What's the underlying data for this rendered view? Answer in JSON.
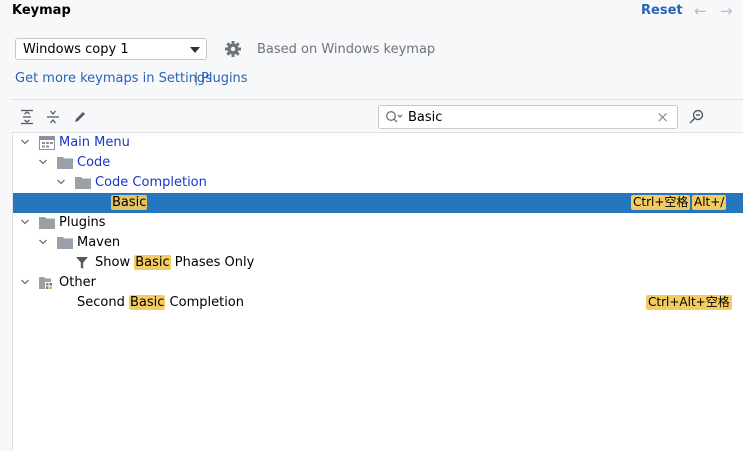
{
  "header": {
    "title": "Keymap",
    "reset_label": "Reset",
    "back_arrow": "←",
    "forward_arrow": "→"
  },
  "keymap_select": {
    "selected": "Windows copy 1",
    "based_on": "Based on Windows keymap"
  },
  "links": {
    "get_more_prefix": "Get more keymaps in Settings",
    "separator": "|",
    "plugins": "Plugins"
  },
  "search": {
    "value": "Basic",
    "clear": "×"
  },
  "tree": {
    "main_menu": "Main Menu",
    "code": "Code",
    "code_completion": "Code Completion",
    "basic": "Basic",
    "basic_shortcut_1": "Ctrl+空格",
    "basic_shortcut_2": "Alt+/",
    "plugins": "Plugins",
    "maven": "Maven",
    "show_prefix": "Show ",
    "show_highlight": "Basic",
    "show_suffix": " Phases Only",
    "other": "Other",
    "second_prefix": "Second ",
    "second_highlight": "Basic",
    "second_suffix": " Completion",
    "second_shortcut": "Ctrl+Alt+空格"
  },
  "colors": {
    "accent": "#2b63b7",
    "selection": "#2675bf",
    "highlight": "#f2cb61",
    "folder": "#9aa0a8"
  }
}
